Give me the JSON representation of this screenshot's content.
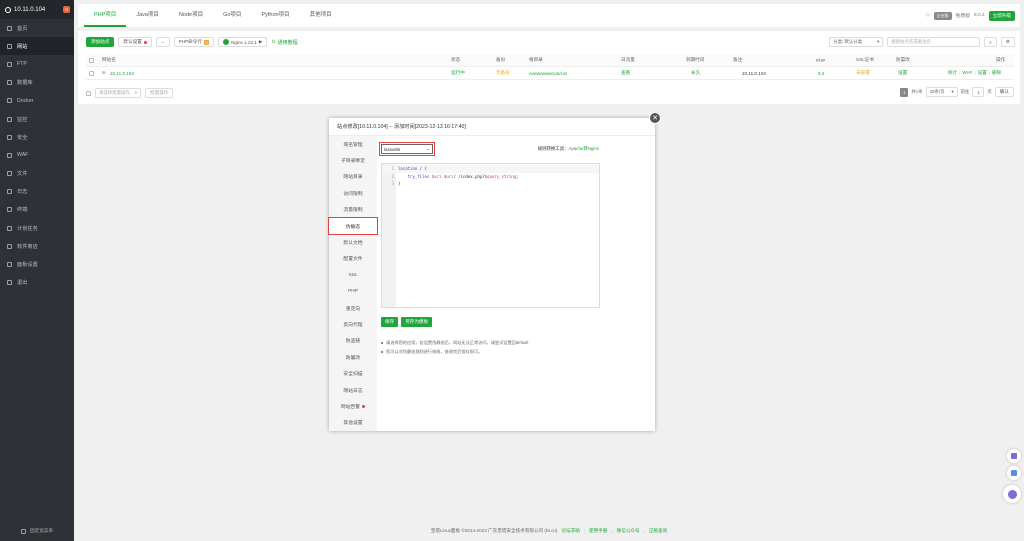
{
  "server": {
    "ip": "10.11.0.104",
    "badge": "0"
  },
  "nav": [
    {
      "label": "首页"
    },
    {
      "label": "网站"
    },
    {
      "label": "FTP"
    },
    {
      "label": "数据库"
    },
    {
      "label": "Docker"
    },
    {
      "label": "监控"
    },
    {
      "label": "安全"
    },
    {
      "label": "WAF"
    },
    {
      "label": "文件"
    },
    {
      "label": "日志"
    },
    {
      "label": "终端"
    },
    {
      "label": "计划任务"
    },
    {
      "label": "软件商店"
    },
    {
      "label": "面板设置"
    },
    {
      "label": "退出"
    }
  ],
  "sidebar_bottom": "固定宽菜单",
  "tabs": [
    {
      "label": "PHP项目"
    },
    {
      "label": "Java项目"
    },
    {
      "label": "Node项目"
    },
    {
      "label": "Go项目"
    },
    {
      "label": "Python项目"
    },
    {
      "label": "其他项目"
    }
  ],
  "topright": {
    "edition": "企业版",
    "free": "免费版",
    "version": "8.0.4",
    "renew": "立即升级"
  },
  "toolbar": {
    "add_site": "添加站点",
    "default": "默认设置",
    "php_cmd": "PHP命令行",
    "php_count": "0",
    "nginx": "Nginx 1.22.1",
    "help": "通用教程"
  },
  "filters": {
    "sort": "分类: 默认分类",
    "search_placeholder": "搜索站点名或备注名"
  },
  "table": {
    "headers": [
      "网站名",
      "状态",
      "备份",
      "根目录",
      "日流量",
      "到期时间",
      "备注",
      "PHP",
      "SSL证书",
      "防篡改",
      "操作"
    ],
    "rows": [
      {
        "name": "10.11.0.104",
        "status": "运行中",
        "backup": "无备份",
        "root": "/www/wwwroot/cat",
        "traffic": "查看",
        "expire": "永久",
        "remark": "10.11.0.104",
        "php": "8.2",
        "ssl": "未部署",
        "tamper": "设置",
        "ops": [
          "统计",
          "WAF",
          "设置",
          "删除"
        ]
      }
    ]
  },
  "bulk": {
    "select": "请选择批量操作",
    "button": "批量操作"
  },
  "pager": {
    "current": "1",
    "total": "共1条",
    "per_page": "20条/页",
    "jump_label": "前往",
    "jump_value": "1",
    "unit": "页",
    "go": "确认"
  },
  "modal": {
    "title": "站点修改[10.11.0.104] -- 添加时间[2023-12-13 16:17:40]",
    "menu": [
      "域名管理",
      "子目录绑定",
      "网站目录",
      "访问限制",
      "流量限制",
      "伪静态",
      "默认文档",
      "配置文件",
      "SSL",
      "PHP",
      "重定向",
      "反向代理",
      "防盗链",
      "防篡改",
      "安全扫描",
      "网站日志",
      "网站告警",
      "其他设置"
    ],
    "rewrite_select": "laravel5",
    "tool_text": "规则转换工具：",
    "tool_link": "Apache转Nginx",
    "code": [
      {
        "n": "1",
        "text": "location / {"
      },
      {
        "n": "2",
        "text": "    try_files $uri $uri/ /index.php?$query_string;"
      },
      {
        "n": "3",
        "text": "}"
      }
    ],
    "save": "保存",
    "save_template": "另存为模板",
    "tips": [
      "请选择您的应用，若设置伪静态后，网站无法正常访问，请尝试设置回default",
      "您可以对伪静态规则进行修改，修改完后保存即可。"
    ]
  },
  "footer": {
    "copyright": "宝塔Linux面板 ©2014-2023 广东堡塔安全技术有限公司 (bt.cn)",
    "links": [
      "论坛求助",
      "使用手册",
      "微信公众号",
      "正版查询"
    ]
  }
}
